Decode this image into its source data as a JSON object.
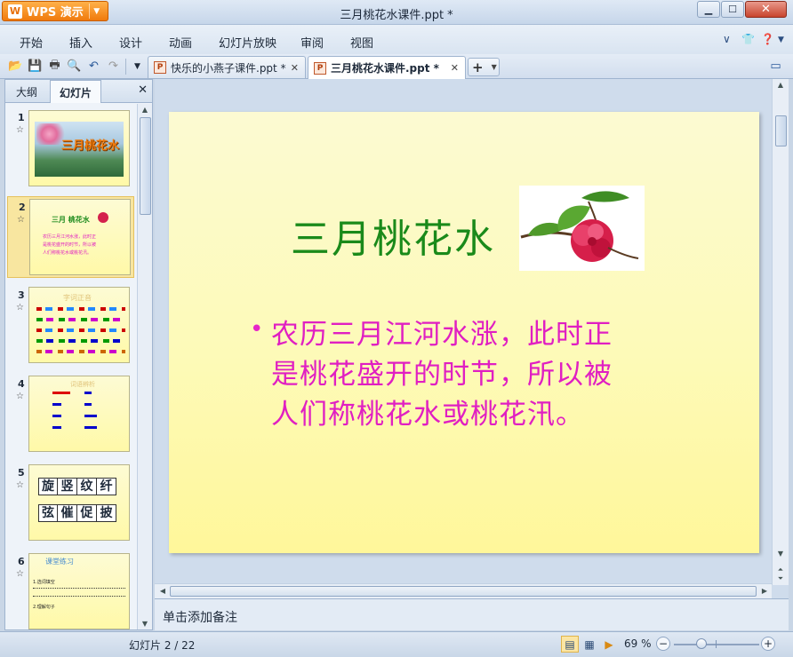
{
  "app": {
    "button_label": "WPS 演示",
    "window_title": "三月桃花水课件.ppt *"
  },
  "menu": {
    "items": [
      "开始",
      "插入",
      "设计",
      "动画",
      "幻灯片放映",
      "审阅",
      "视图"
    ]
  },
  "doc_tabs": [
    {
      "label": "快乐的小燕子课件.ppt *",
      "active": false
    },
    {
      "label": "三月桃花水课件.ppt *",
      "active": true
    }
  ],
  "left_panel": {
    "tabs": [
      "大纲",
      "幻灯片"
    ],
    "active_tab": "幻灯片",
    "slides": [
      {
        "num": "1",
        "selected": false,
        "title": "三月桃花水"
      },
      {
        "num": "2",
        "selected": true,
        "title": "三月 桃花水",
        "lines": [
          "农历三月江河水涨，此时正",
          "是桃花盛开的时节，所以被",
          "人们称桃花水或桃花汛。"
        ]
      },
      {
        "num": "3",
        "selected": false,
        "title": "字词正音"
      },
      {
        "num": "4",
        "selected": false,
        "title": "词语辨析"
      },
      {
        "num": "5",
        "selected": false,
        "grid": [
          "旋",
          "竖",
          "纹",
          "纤",
          "弦",
          "催",
          "促",
          "披"
        ]
      },
      {
        "num": "6",
        "selected": false,
        "title": "课堂练习",
        "lines": [
          "1.选词填空",
          "2.理解句子"
        ]
      }
    ]
  },
  "slide": {
    "title": "三月桃花水",
    "bullet_lines": [
      "农历三月江河水涨，此时正",
      "是桃花盛开的时节，所以被",
      "人们称桃花水或桃花汛。"
    ]
  },
  "notes": {
    "placeholder": "单击添加备注"
  },
  "status": {
    "slide_counter": "幻灯片 2 / 22",
    "zoom": "69 %"
  },
  "colors": {
    "title_green": "#1a8a1a",
    "bullet_magenta": "#e01fc2",
    "slide_bg": "#fdfab8",
    "accent_orange": "#f07a0c"
  }
}
